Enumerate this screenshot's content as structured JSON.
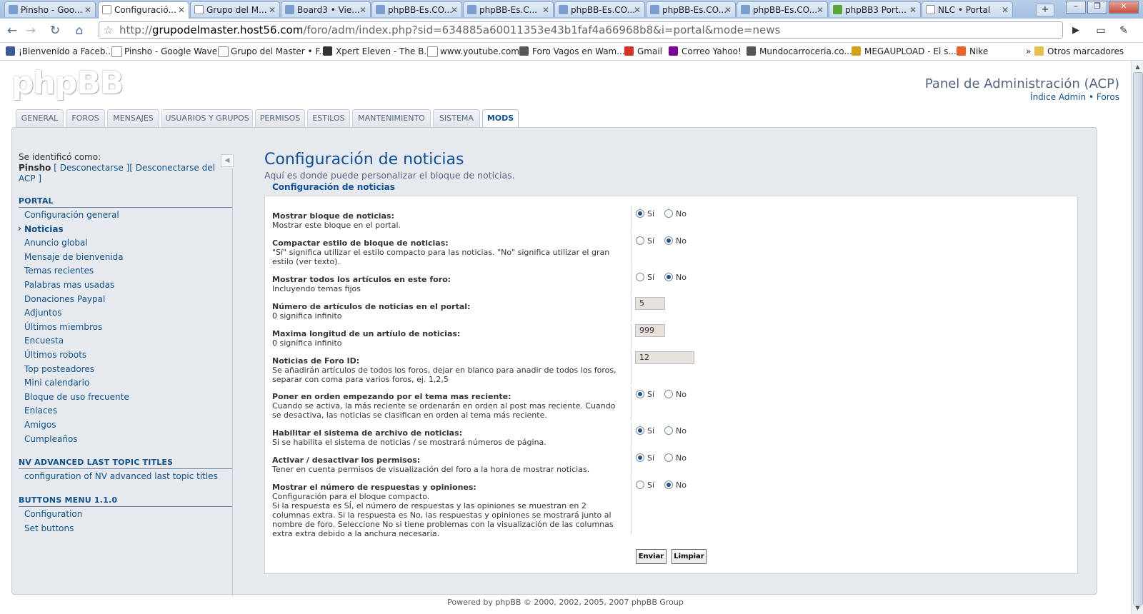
{
  "browser": {
    "tabs": [
      {
        "label": "Pinsho - Goo...",
        "icon": "wave"
      },
      {
        "label": "Configuració...",
        "icon": "page",
        "active": true
      },
      {
        "label": "Grupo del M...",
        "icon": "page"
      },
      {
        "label": "Board3 • Vie...",
        "icon": "board"
      },
      {
        "label": "phpBB-Es.CO...",
        "icon": "phpbb"
      },
      {
        "label": "phpBB-Es.C...",
        "icon": "phpbb"
      },
      {
        "label": "phpBB-Es.CO...",
        "icon": "phpbb"
      },
      {
        "label": "phpBB-Es.CO...",
        "icon": "phpbb"
      },
      {
        "label": "phpBB-Es.CO...",
        "icon": "phpbb"
      },
      {
        "label": "phpBB3 Port...",
        "icon": "green"
      },
      {
        "label": "NLC • Portal",
        "icon": "page"
      }
    ],
    "url_prefix": "http://",
    "url_host": "grupodelmaster.host56.com",
    "url_path": "/foro/adm/index.php?sid=634885a60011353e43b1faf4a66968b8&i=portal&mode=news",
    "bookmarks": [
      {
        "label": "¡Bienvenido a Faceb...",
        "color": "#3b5998"
      },
      {
        "label": "Pinsho - Google Wave",
        "color": "#ffffff"
      },
      {
        "label": "Grupo del Master • F...",
        "color": "#ffffff"
      },
      {
        "label": "Xpert Eleven - The B...",
        "color": "#333333"
      },
      {
        "label": "www.youtube.com",
        "color": "#ffffff"
      },
      {
        "label": "Foro Vagos en Wam...",
        "color": "#555555"
      },
      {
        "label": "Gmail",
        "color": "#d93025"
      },
      {
        "label": "Correo Yahoo!",
        "color": "#7b0099"
      },
      {
        "label": "Mundocarroceria.co...",
        "color": "#555555"
      },
      {
        "label": "MEGAUPLOAD - El s...",
        "color": "#d4a017"
      },
      {
        "label": "Nike",
        "color": "#e8622a"
      }
    ],
    "bookmarks_more": "»",
    "other_bookmarks": "Otros marcadores"
  },
  "header": {
    "logo": "phpBB",
    "title": "Panel de Administración (ACP)",
    "link_admin": "Índice Admin",
    "link_sep": "•",
    "link_forums": "Foros"
  },
  "main_tabs": [
    "GENERAL",
    "FOROS",
    "MENSAJES",
    "USUARIOS Y GRUPOS",
    "PERMISOS",
    "ESTILOS",
    "MANTENIMIENTO",
    "SISTEMA",
    "MODS"
  ],
  "sidebar": {
    "logged_as": "Se identificó como:",
    "user": "Pinsho",
    "logout_1": "[ Desconectarse ]",
    "logout_2": "[ Desconectarse del ACP ]",
    "sections": [
      {
        "title": "PORTAL",
        "items": [
          "Configuración general",
          "Noticias",
          "Anuncio global",
          "Mensaje de bienvenida",
          "Temas recientes",
          "Palabras mas usadas",
          "Donaciones Paypal",
          "Adjuntos",
          "Últimos miembros",
          "Encuesta",
          "Últimos robots",
          "Top posteadores",
          "Mini calendario",
          "Bloque de uso frecuente",
          "Enlaces",
          "Amigos",
          "Cumpleaños"
        ]
      },
      {
        "title": "NV ADVANCED LAST TOPIC TITLES",
        "items": [
          "configuration of NV advanced last topic titles"
        ]
      },
      {
        "title": "BUTTONS MENU 1.1.0",
        "items": [
          "Configuration",
          "Set buttons"
        ]
      }
    ]
  },
  "main": {
    "title": "Configuración de noticias",
    "description": "Aquí es donde puede personalizar el bloque de noticias.",
    "legend": "Configuración de noticias",
    "yes": "Sí",
    "no": "No",
    "rows": [
      {
        "title": "Mostrar bloque de noticias:",
        "desc": "Mostrar este bloque en el portal.",
        "type": "radio",
        "value": "yes"
      },
      {
        "title": "Compactar estilo de bloque de noticias:",
        "desc": "\"Sí\" significa utilizar el estilo compacto para las noticias. \"No\" significa utilizar el gran estilo (ver texto).",
        "type": "radio",
        "value": "no"
      },
      {
        "title": "Mostrar todos los artículos en este foro:",
        "desc": "Incluyendo temas fijos",
        "type": "radio",
        "value": "no"
      },
      {
        "title": "Número de artículos de noticias en el portal:",
        "desc": "0 significa infinito",
        "type": "text",
        "value": "5"
      },
      {
        "title": "Maxima longitud de un artíulo de noticias:",
        "desc": "0 significa infinito",
        "type": "text",
        "value": "999"
      },
      {
        "title": "Noticias de Foro ID:",
        "desc": "Se añadirán artículos de todos los foros, dejar en blanco para anadir de todos los foros, separar con coma para varios foros, ej. 1,2,5",
        "type": "text",
        "value": "12"
      },
      {
        "title": "Poner en orden empezando por el tema mas reciente:",
        "desc": "Cuando se activa, la más reciente se ordenarán en orden al post mas reciente. Cuando se desactiva, las noticias se clasifican en orden al tema más reciente.",
        "type": "radio",
        "value": "yes"
      },
      {
        "title": "Habilitar el sistema de archivo de noticias:",
        "desc": "Si se habilita el sistema de noticias / se mostrará números de página.",
        "type": "radio",
        "value": "yes"
      },
      {
        "title": "Activar / desactivar los permisos:",
        "desc": "Tener en cuenta permisos de visualización del foro a la hora de mostrar noticias.",
        "type": "radio",
        "value": "yes"
      },
      {
        "title": "Mostrar el número de respuestas y opiniones:",
        "desc": "Configuración para el bloque compacto.\nSi la respuesta es SÍ, el número de respuestas y las opiniones se muestran en 2 columnas extra. Si la respuesta es No, las respuestas y opiniones se mostrará junto al nombre de foro. Seleccione No si tiene problemas con la visualización de las columnas extra extra debido a la anchura necesaria.",
        "type": "radio",
        "value": "no"
      }
    ],
    "submit": "Enviar",
    "reset": "Limpiar"
  },
  "footer": "Powered by phpBB © 2000, 2002, 2005, 2007 phpBB Group"
}
